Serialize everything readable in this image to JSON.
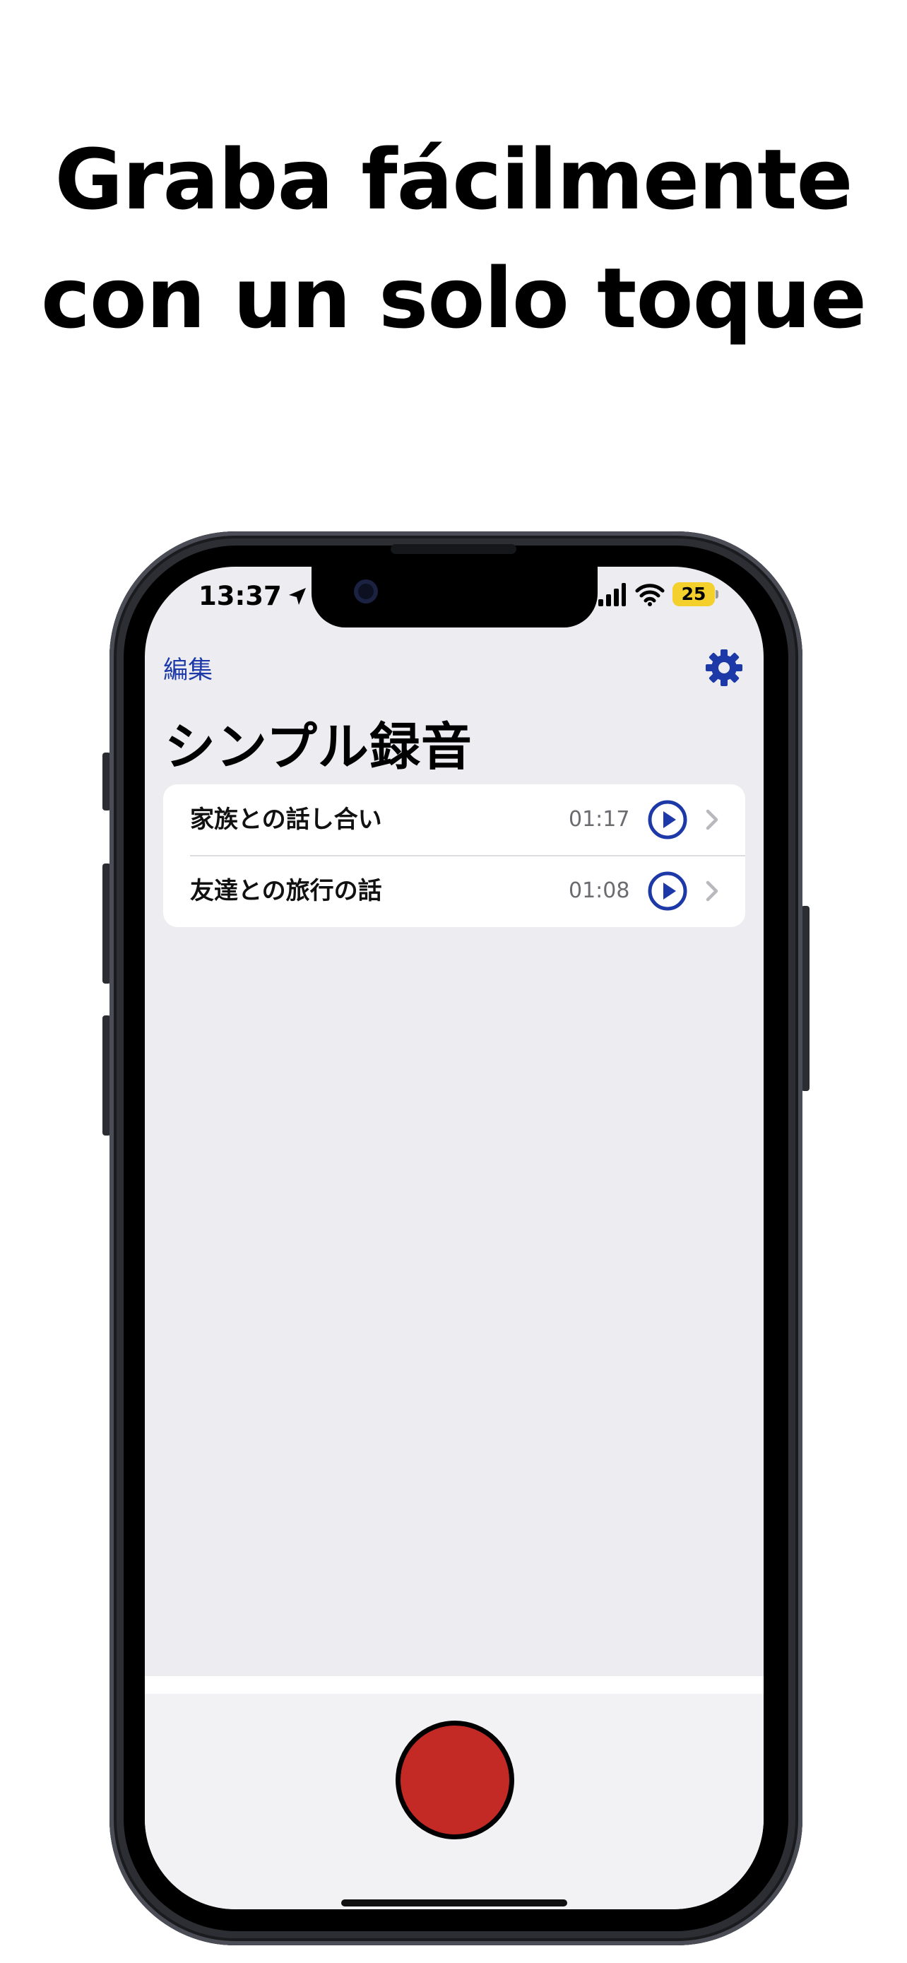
{
  "headline": {
    "line1": "Graba fácilmente",
    "line2": "con un solo toque"
  },
  "status_bar": {
    "time": "13:37",
    "battery": "25"
  },
  "nav": {
    "edit_label": "編集",
    "title": "シンプル録音"
  },
  "recordings": [
    {
      "title": "家族との話し合い",
      "duration": "01:17"
    },
    {
      "title": "友達との旅行の話",
      "duration": "01:08"
    }
  ],
  "colors": {
    "accent": "#1d39a8",
    "record": "#c42a25",
    "battery": "#f4d02c",
    "background": "#ececf1"
  },
  "icons": [
    "location-arrow-icon",
    "signal-icon",
    "wifi-icon",
    "gear-icon",
    "play-icon",
    "chevron-right-icon",
    "record-icon"
  ]
}
